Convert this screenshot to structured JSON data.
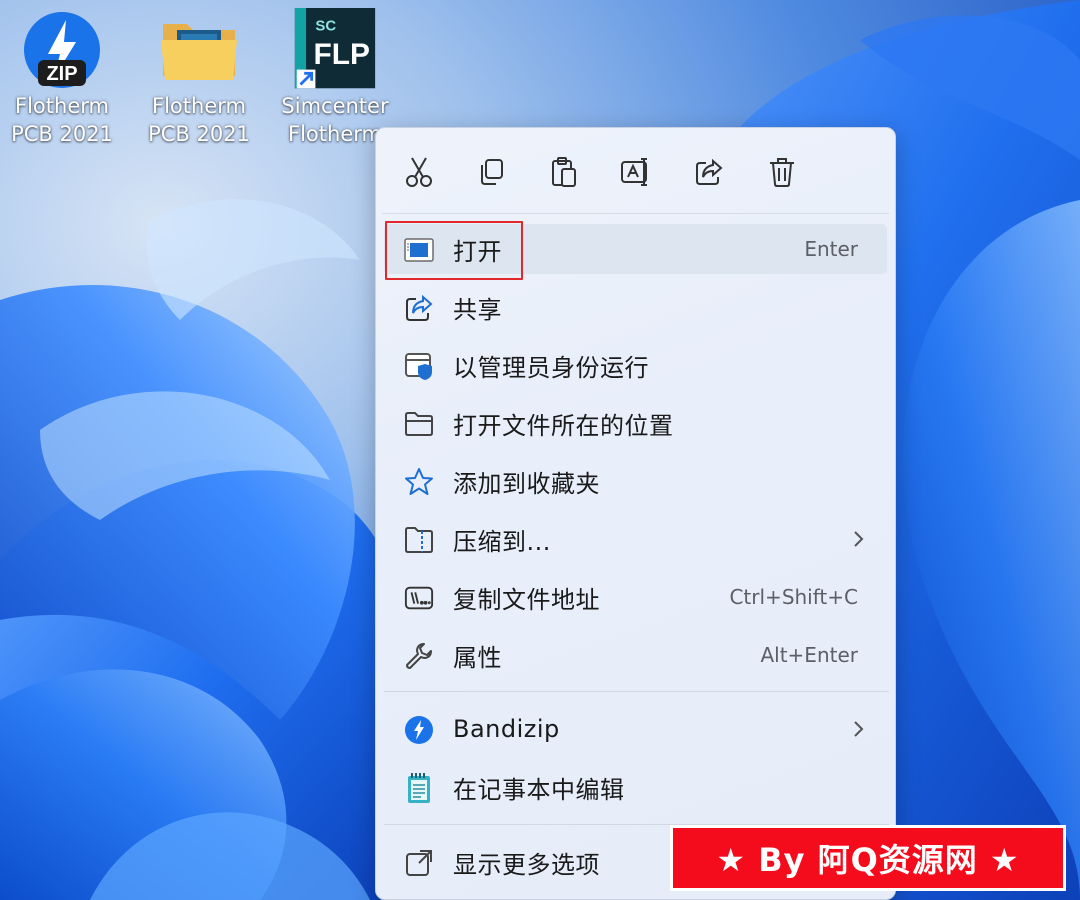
{
  "desktop": {
    "icons": [
      {
        "label_line1": "Flotherm",
        "label_line2": "PCB 2021",
        "icon": "bandizip-zip-icon",
        "badge": "ZIP"
      },
      {
        "label_line1": "Flotherm",
        "label_line2": "PCB 2021",
        "icon": "folder-icon"
      },
      {
        "label_line1": "Simcenter",
        "label_line2": "Flotherm",
        "icon": "flp-app-icon",
        "badge_top": "SC",
        "badge_main": "FLP"
      }
    ]
  },
  "context_menu": {
    "toolbar": [
      {
        "name": "cut-icon",
        "tooltip": "剪切"
      },
      {
        "name": "copy-icon",
        "tooltip": "复制"
      },
      {
        "name": "paste-icon",
        "tooltip": "粘贴"
      },
      {
        "name": "rename-icon",
        "tooltip": "重命名"
      },
      {
        "name": "share-icon",
        "tooltip": "共享"
      },
      {
        "name": "delete-icon",
        "tooltip": "删除"
      }
    ],
    "items": [
      {
        "label": "打开",
        "shortcut": "Enter",
        "icon": "open-window-icon",
        "highlighted": true
      },
      {
        "label": "共享",
        "shortcut": "",
        "icon": "share-icon"
      },
      {
        "label": "以管理员身份运行",
        "shortcut": "",
        "icon": "admin-shield-icon"
      },
      {
        "label": "打开文件所在的位置",
        "shortcut": "",
        "icon": "folder-outline-icon"
      },
      {
        "label": "添加到收藏夹",
        "shortcut": "",
        "icon": "star-icon"
      },
      {
        "label": "压缩到...",
        "shortcut": "",
        "icon": "zip-folder-icon",
        "submenu": true
      },
      {
        "label": "复制文件地址",
        "shortcut": "Ctrl+Shift+C",
        "icon": "copy-path-icon"
      },
      {
        "label": "属性",
        "shortcut": "Alt+Enter",
        "icon": "wrench-icon"
      },
      {
        "label": "Bandizip",
        "shortcut": "",
        "icon": "bandizip-icon",
        "submenu": true
      },
      {
        "label": "在记事本中编辑",
        "shortcut": "",
        "icon": "notepad-icon"
      },
      {
        "label": "显示更多选项",
        "shortcut": "",
        "icon": "show-more-icon"
      }
    ]
  },
  "watermark": {
    "text": "★ By 阿Q资源网 ★"
  },
  "colors": {
    "accent": "#0f6cbd",
    "highlight_border": "#e2282d",
    "watermark_bg": "#f40c1d"
  }
}
